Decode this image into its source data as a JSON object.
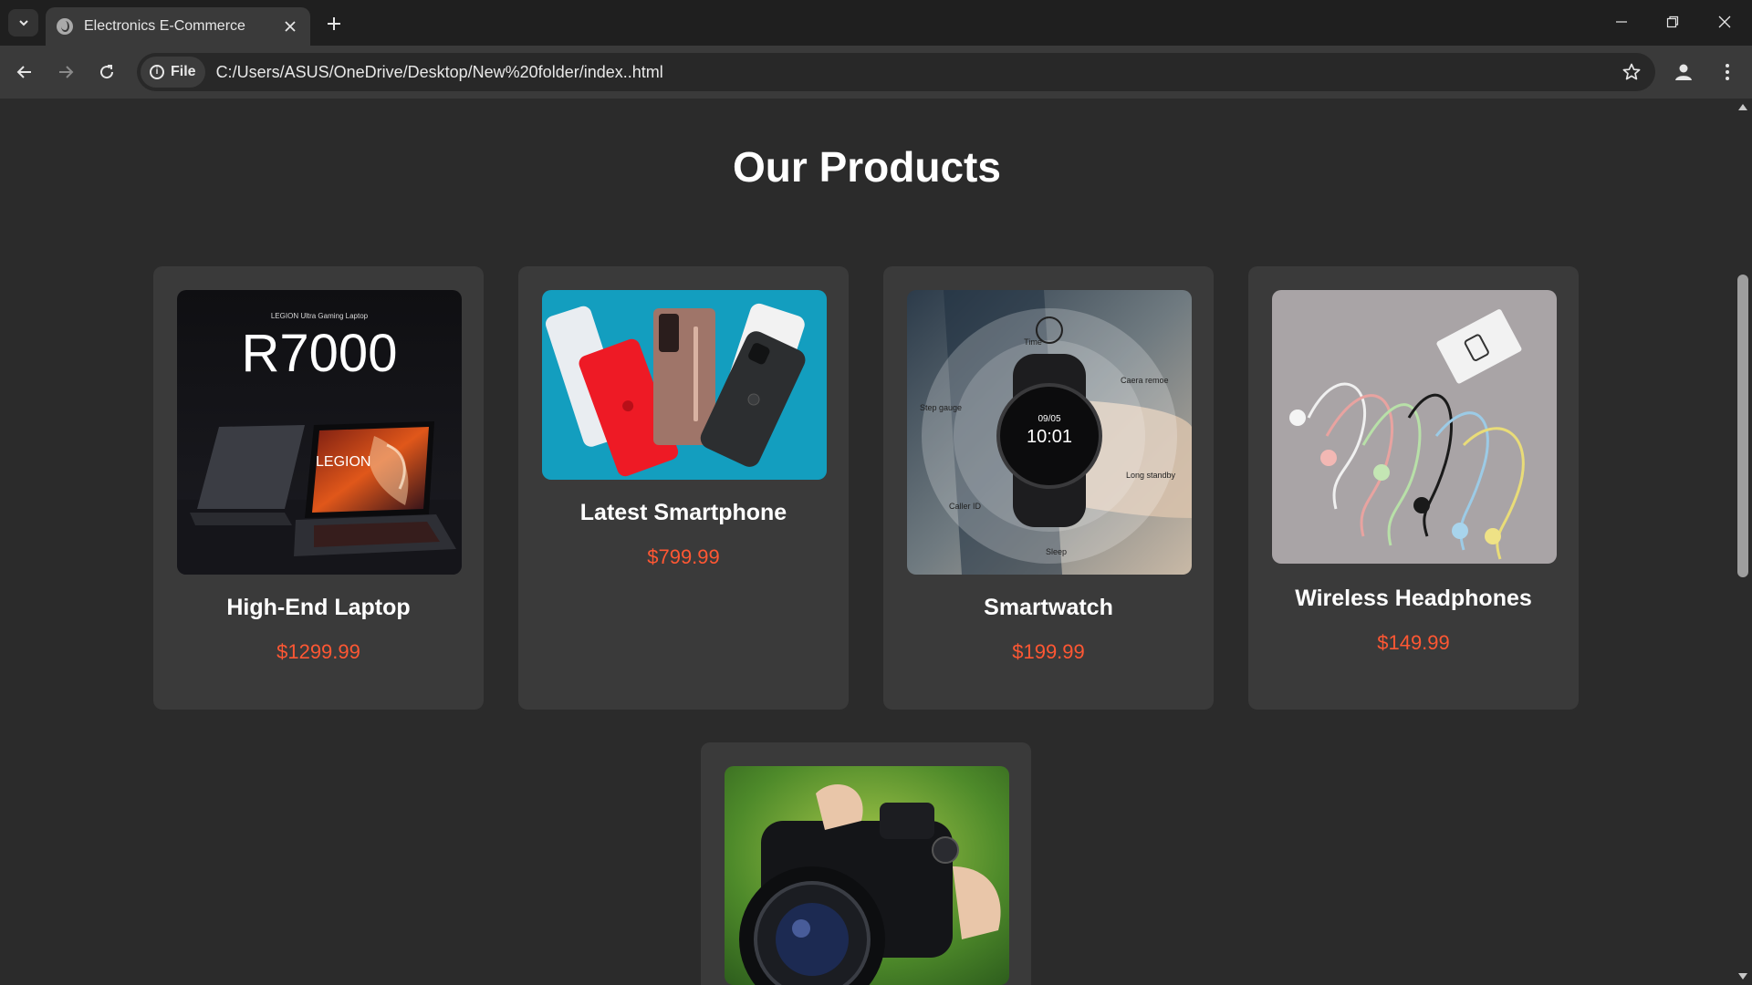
{
  "browser": {
    "tab_title": "Electronics E-Commerce",
    "chip_label": "File",
    "url": "C:/Users/ASUS/OneDrive/Desktop/New%20folder/index..html"
  },
  "page": {
    "title": "Our Products"
  },
  "products": [
    {
      "name": "High-End Laptop",
      "price": "$1299.99",
      "image": {
        "small": "LEGION Ultra Gaming Laptop",
        "big": "R7000",
        "brand": "LEGION"
      }
    },
    {
      "name": "Latest Smartphone",
      "price": "$799.99"
    },
    {
      "name": "Smartwatch",
      "price": "$199.99",
      "image": {
        "time_label": "Time",
        "camera_label": "Caera remoe",
        "step_label": "Step gauge",
        "standby_label": "Long standby",
        "caller_label": "Caller ID",
        "sleep_label": "Sleep",
        "date": "09/05",
        "clock": "10:01"
      }
    },
    {
      "name": "Wireless Headphones",
      "price": "$149.99"
    },
    {
      "name": "",
      "price": ""
    }
  ],
  "colors": {
    "background": "#2b2b2b",
    "card": "#3a3a3a",
    "price": "#ff5733",
    "title": "#ffffff"
  }
}
